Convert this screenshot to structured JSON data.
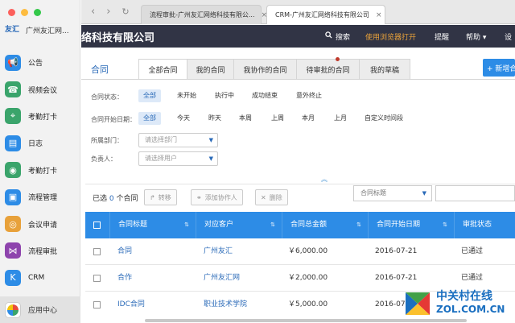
{
  "sidebar": {
    "app_name": "广州友汇网...",
    "logo_text": "友汇",
    "items": [
      {
        "label": "公告",
        "icon": "megaphone-icon",
        "color": "#2d8ce6",
        "glyph": "📢"
      },
      {
        "label": "视频会议",
        "icon": "phone-icon",
        "color": "#3aa46b",
        "glyph": "☎"
      },
      {
        "label": "考勤打卡",
        "icon": "location-pin-icon",
        "color": "#3aa46b",
        "glyph": "⌖"
      },
      {
        "label": "日志",
        "icon": "notebook-icon",
        "color": "#2d8ce6",
        "glyph": "▤"
      },
      {
        "label": "考勤打卡",
        "icon": "bulb-icon",
        "color": "#3aa46b",
        "glyph": "◉"
      },
      {
        "label": "流程管理",
        "icon": "monitor-icon",
        "color": "#2d8ce6",
        "glyph": "▣"
      },
      {
        "label": "会议申请",
        "icon": "meeting-icon",
        "color": "#e8a13a",
        "glyph": "◎"
      },
      {
        "label": "流程审批",
        "icon": "share-icon",
        "color": "#8e44ad",
        "glyph": "⋈"
      },
      {
        "label": "CRM",
        "icon": "crm-k-icon",
        "color": "#2d8ce6",
        "glyph": "K"
      }
    ],
    "app_center": "应用中心"
  },
  "browser": {
    "back": "‹",
    "forward": "›",
    "reload": "↻",
    "tabs": [
      {
        "title": "流程审批-广州友汇网络科技有限公...",
        "close": "×"
      },
      {
        "title": "CRM-广州友汇网络科技有限公司",
        "close": "×"
      }
    ]
  },
  "header": {
    "company": "络科技有限公司",
    "search": "搜索",
    "open_browser": "使用浏览器打开",
    "remind": "提醒",
    "help": "帮助 ▾",
    "settings": "设"
  },
  "page": {
    "title": "合同",
    "tabs": [
      "全部合同",
      "我的合同",
      "我协作的合同",
      "待审批的合同",
      "我的草稿"
    ],
    "new_button": "+ 新增合"
  },
  "filters": {
    "status_label": "合同状态：",
    "status_options": [
      "全部",
      "未开始",
      "执行中",
      "成功结束",
      "意外终止"
    ],
    "date_label": "合同开始日期：",
    "date_options": [
      "全部",
      "今天",
      "昨天",
      "本周",
      "上周",
      "本月",
      "上月",
      "自定义时间段"
    ],
    "dept_label": "所属部门：",
    "dept_placeholder": "请选择部门",
    "owner_label": "负责人：",
    "owner_placeholder": "请选择用户",
    "collapse": "︽"
  },
  "toolbar": {
    "selected_prefix": "已选",
    "selected_count": "0",
    "selected_suffix": "个合同",
    "transfer": "转移",
    "add_collaborator": "添加协作人",
    "delete": "删除",
    "search_field": "合同标题"
  },
  "table": {
    "columns": [
      "合同标题",
      "对应客户",
      "合同总金额",
      "合同开始日期",
      "审批状态"
    ],
    "rows": [
      {
        "title": "合同",
        "customer": "广州友汇",
        "amount": "￥6,000.00",
        "date": "2016-07-21",
        "status": "已通过"
      },
      {
        "title": "合作",
        "customer": "广州友汇网",
        "amount": "￥2,000.00",
        "date": "2016-07-21",
        "status": "已通过"
      },
      {
        "title": "IDC合同",
        "customer": "职业技术学院",
        "amount": "￥5,000.00",
        "date": "2016-07",
        "status": ""
      }
    ]
  },
  "watermark": {
    "line1": "中关村在线",
    "line2": "ZOL.COM.CN"
  }
}
